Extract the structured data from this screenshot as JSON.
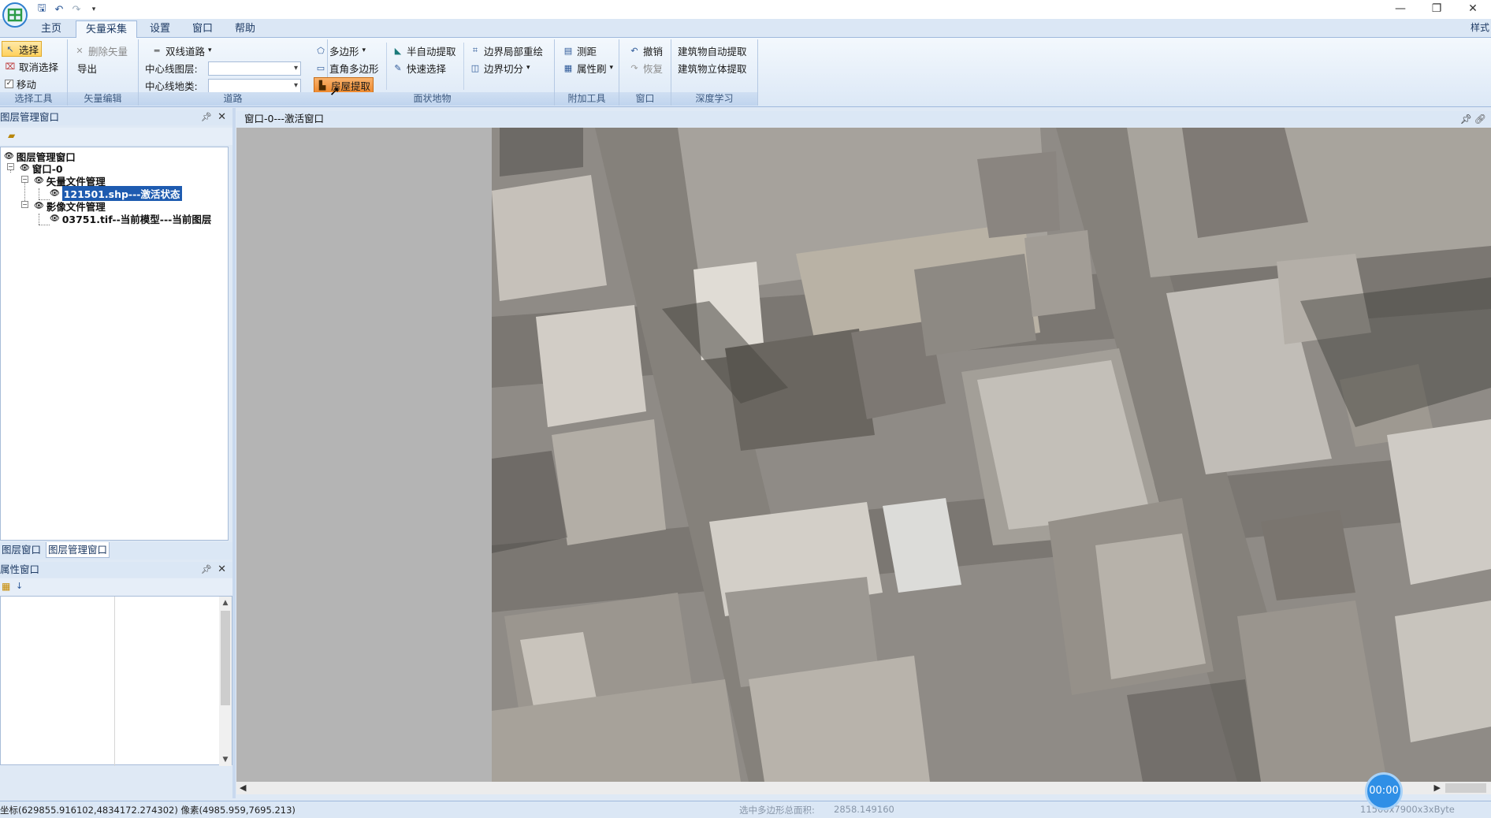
{
  "qat_icons": [
    "save-icon",
    "undo-icon",
    "redo-icon",
    "customize-icon"
  ],
  "tabs": [
    "主页",
    "矢量采集",
    "设置",
    "窗口",
    "帮助"
  ],
  "style_label": "样式",
  "ribbon": {
    "select_tools": {
      "select": "选择",
      "deselect": "取消选择",
      "move": "移动",
      "label": "选择工具"
    },
    "vector_edit": {
      "delete": "删除矢量",
      "export": "导出",
      "label": "矢量编辑"
    },
    "road": {
      "double_line": "双线道路",
      "centerline_layer": "中心线图层:",
      "centerline_class": "中心线地类:",
      "label": "道路"
    },
    "surface": {
      "polygon": "多边形",
      "right_angle": "直角多边形",
      "roof": "房屋提取",
      "semi_auto": "半自动提取",
      "quick_select": "快速选择",
      "boundary_redraw": "边界局部重绘",
      "boundary_split": "边界切分",
      "label": "面状地物"
    },
    "extra": {
      "measure": "测距",
      "attr_brush": "属性刷",
      "label": "附加工具"
    },
    "window": {
      "undo": "撤销",
      "redo": "恢复",
      "label": "窗口"
    },
    "deep": {
      "auto_extract": "建筑物自动提取",
      "stereo_extract": "建筑物立体提取",
      "label": "深度学习"
    }
  },
  "layer_pane": {
    "title": "图层管理窗口",
    "tree": {
      "root": "图层管理窗口",
      "window": "窗口-0",
      "vector_group": "矢量文件管理",
      "vector_file": "121501.shp---激活状态",
      "image_group": "影像文件管理",
      "image_file": "03751.tif--当前模型---当前图层"
    },
    "bottom_tabs": [
      "图层窗口",
      "图层管理窗口"
    ]
  },
  "attr_pane": {
    "title": "属性窗口"
  },
  "doc_tab": "窗口-0---激活窗口",
  "status": {
    "coords": "坐标(629855.916102,4834172.274302) 像素(4985.959,7695.213)",
    "area": "选中多边形总面积:",
    "area_value": "2858.149160",
    "image_info": "11500x7900x3xByte"
  },
  "timer": "00:00"
}
